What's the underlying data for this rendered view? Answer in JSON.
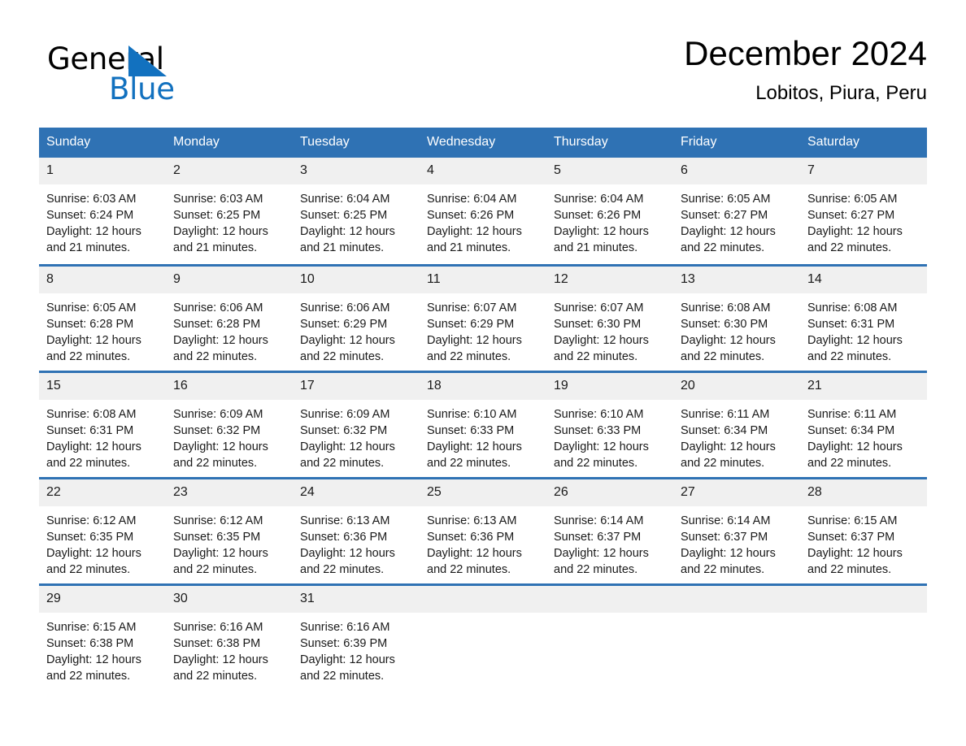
{
  "brand": {
    "name_part1": "General",
    "name_part2": "Blue",
    "triangle_color": "#1271bf"
  },
  "header": {
    "month_title": "December 2024",
    "location": "Lobitos, Piura, Peru"
  },
  "theme": {
    "header_blue": "#2f72b4",
    "daynum_band": "#f0f0f0",
    "text": "#1a1a1a"
  },
  "calendar": {
    "weekday_headers": [
      "Sunday",
      "Monday",
      "Tuesday",
      "Wednesday",
      "Thursday",
      "Friday",
      "Saturday"
    ],
    "weeks": [
      [
        {
          "day": "1",
          "sunrise": "Sunrise: 6:03 AM",
          "sunset": "Sunset: 6:24 PM",
          "daylight": "Daylight: 12 hours and 21 minutes."
        },
        {
          "day": "2",
          "sunrise": "Sunrise: 6:03 AM",
          "sunset": "Sunset: 6:25 PM",
          "daylight": "Daylight: 12 hours and 21 minutes."
        },
        {
          "day": "3",
          "sunrise": "Sunrise: 6:04 AM",
          "sunset": "Sunset: 6:25 PM",
          "daylight": "Daylight: 12 hours and 21 minutes."
        },
        {
          "day": "4",
          "sunrise": "Sunrise: 6:04 AM",
          "sunset": "Sunset: 6:26 PM",
          "daylight": "Daylight: 12 hours and 21 minutes."
        },
        {
          "day": "5",
          "sunrise": "Sunrise: 6:04 AM",
          "sunset": "Sunset: 6:26 PM",
          "daylight": "Daylight: 12 hours and 21 minutes."
        },
        {
          "day": "6",
          "sunrise": "Sunrise: 6:05 AM",
          "sunset": "Sunset: 6:27 PM",
          "daylight": "Daylight: 12 hours and 22 minutes."
        },
        {
          "day": "7",
          "sunrise": "Sunrise: 6:05 AM",
          "sunset": "Sunset: 6:27 PM",
          "daylight": "Daylight: 12 hours and 22 minutes."
        }
      ],
      [
        {
          "day": "8",
          "sunrise": "Sunrise: 6:05 AM",
          "sunset": "Sunset: 6:28 PM",
          "daylight": "Daylight: 12 hours and 22 minutes."
        },
        {
          "day": "9",
          "sunrise": "Sunrise: 6:06 AM",
          "sunset": "Sunset: 6:28 PM",
          "daylight": "Daylight: 12 hours and 22 minutes."
        },
        {
          "day": "10",
          "sunrise": "Sunrise: 6:06 AM",
          "sunset": "Sunset: 6:29 PM",
          "daylight": "Daylight: 12 hours and 22 minutes."
        },
        {
          "day": "11",
          "sunrise": "Sunrise: 6:07 AM",
          "sunset": "Sunset: 6:29 PM",
          "daylight": "Daylight: 12 hours and 22 minutes."
        },
        {
          "day": "12",
          "sunrise": "Sunrise: 6:07 AM",
          "sunset": "Sunset: 6:30 PM",
          "daylight": "Daylight: 12 hours and 22 minutes."
        },
        {
          "day": "13",
          "sunrise": "Sunrise: 6:08 AM",
          "sunset": "Sunset: 6:30 PM",
          "daylight": "Daylight: 12 hours and 22 minutes."
        },
        {
          "day": "14",
          "sunrise": "Sunrise: 6:08 AM",
          "sunset": "Sunset: 6:31 PM",
          "daylight": "Daylight: 12 hours and 22 minutes."
        }
      ],
      [
        {
          "day": "15",
          "sunrise": "Sunrise: 6:08 AM",
          "sunset": "Sunset: 6:31 PM",
          "daylight": "Daylight: 12 hours and 22 minutes."
        },
        {
          "day": "16",
          "sunrise": "Sunrise: 6:09 AM",
          "sunset": "Sunset: 6:32 PM",
          "daylight": "Daylight: 12 hours and 22 minutes."
        },
        {
          "day": "17",
          "sunrise": "Sunrise: 6:09 AM",
          "sunset": "Sunset: 6:32 PM",
          "daylight": "Daylight: 12 hours and 22 minutes."
        },
        {
          "day": "18",
          "sunrise": "Sunrise: 6:10 AM",
          "sunset": "Sunset: 6:33 PM",
          "daylight": "Daylight: 12 hours and 22 minutes."
        },
        {
          "day": "19",
          "sunrise": "Sunrise: 6:10 AM",
          "sunset": "Sunset: 6:33 PM",
          "daylight": "Daylight: 12 hours and 22 minutes."
        },
        {
          "day": "20",
          "sunrise": "Sunrise: 6:11 AM",
          "sunset": "Sunset: 6:34 PM",
          "daylight": "Daylight: 12 hours and 22 minutes."
        },
        {
          "day": "21",
          "sunrise": "Sunrise: 6:11 AM",
          "sunset": "Sunset: 6:34 PM",
          "daylight": "Daylight: 12 hours and 22 minutes."
        }
      ],
      [
        {
          "day": "22",
          "sunrise": "Sunrise: 6:12 AM",
          "sunset": "Sunset: 6:35 PM",
          "daylight": "Daylight: 12 hours and 22 minutes."
        },
        {
          "day": "23",
          "sunrise": "Sunrise: 6:12 AM",
          "sunset": "Sunset: 6:35 PM",
          "daylight": "Daylight: 12 hours and 22 minutes."
        },
        {
          "day": "24",
          "sunrise": "Sunrise: 6:13 AM",
          "sunset": "Sunset: 6:36 PM",
          "daylight": "Daylight: 12 hours and 22 minutes."
        },
        {
          "day": "25",
          "sunrise": "Sunrise: 6:13 AM",
          "sunset": "Sunset: 6:36 PM",
          "daylight": "Daylight: 12 hours and 22 minutes."
        },
        {
          "day": "26",
          "sunrise": "Sunrise: 6:14 AM",
          "sunset": "Sunset: 6:37 PM",
          "daylight": "Daylight: 12 hours and 22 minutes."
        },
        {
          "day": "27",
          "sunrise": "Sunrise: 6:14 AM",
          "sunset": "Sunset: 6:37 PM",
          "daylight": "Daylight: 12 hours and 22 minutes."
        },
        {
          "day": "28",
          "sunrise": "Sunrise: 6:15 AM",
          "sunset": "Sunset: 6:37 PM",
          "daylight": "Daylight: 12 hours and 22 minutes."
        }
      ],
      [
        {
          "day": "29",
          "sunrise": "Sunrise: 6:15 AM",
          "sunset": "Sunset: 6:38 PM",
          "daylight": "Daylight: 12 hours and 22 minutes."
        },
        {
          "day": "30",
          "sunrise": "Sunrise: 6:16 AM",
          "sunset": "Sunset: 6:38 PM",
          "daylight": "Daylight: 12 hours and 22 minutes."
        },
        {
          "day": "31",
          "sunrise": "Sunrise: 6:16 AM",
          "sunset": "Sunset: 6:39 PM",
          "daylight": "Daylight: 12 hours and 22 minutes."
        },
        {
          "day": "",
          "sunrise": "",
          "sunset": "",
          "daylight": ""
        },
        {
          "day": "",
          "sunrise": "",
          "sunset": "",
          "daylight": ""
        },
        {
          "day": "",
          "sunrise": "",
          "sunset": "",
          "daylight": ""
        },
        {
          "day": "",
          "sunrise": "",
          "sunset": "",
          "daylight": ""
        }
      ]
    ]
  }
}
